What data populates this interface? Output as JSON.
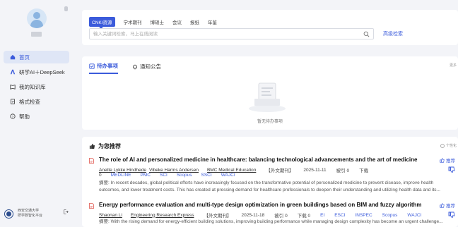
{
  "sidebar": {
    "items": [
      {
        "label": "首页",
        "icon": "home-icon",
        "active": true
      },
      {
        "label": "研学AI＋DeepSeek",
        "icon": "ai-icon"
      },
      {
        "label": "我的知识库",
        "icon": "book-icon"
      },
      {
        "label": "格式检查",
        "icon": "check-doc-icon"
      },
      {
        "label": "帮助",
        "icon": "help-icon"
      }
    ],
    "school_line1": "西安交通大学",
    "school_line2": "研学数智化平台"
  },
  "search": {
    "tabs": [
      "CNKI资源",
      "学术期刊",
      "博硕士",
      "会议",
      "报纸",
      "年鉴"
    ],
    "placeholder": "输入关键词检索，马上在线阅读",
    "value": "",
    "advanced_label": "高级检索"
  },
  "todo": {
    "tab_todo": "待办事项",
    "tab_notice": "通知公告",
    "more": "更多",
    "empty_text": "暂无待办事项"
  },
  "recommend": {
    "header": "为您推荐",
    "personalize": "个性化",
    "recommend_label": "推荐",
    "articles": [
      {
        "title": "The role of AI and personalized medicine in healthcare: balancing technological advancements and the art of medicine",
        "authors": [
          "Anette Lykke Hindhede",
          "Vibeke Harms Andersen"
        ],
        "source": "BMC Medical Education",
        "type": "【外文期刊】",
        "date": "2025-11-11",
        "cited": "被引 0",
        "download": "下载",
        "download_count": "0",
        "indexes": [
          "MEDLINE",
          "PMC",
          "SCI",
          "Scopus",
          "SSCI",
          "WAJCI"
        ],
        "abstract": "摘要: In recent decades, global political efforts have increasingly focused on the transformative potential of personalized medicine to prevent disease, improve health outcomes, and lower treatment costs. This has created at pressing demand for healthcare professionals to deepen their understanding and utilizing health data and its..."
      },
      {
        "title": "Energy performance evaluation and multi-type design optimization in green buildings based on BIM and fuzzy algorithm",
        "authors": [
          "Shaonan Li"
        ],
        "source": "Engineering Research Express",
        "type": "【外文期刊】",
        "date": "2025-11-18",
        "cited": "被引 0",
        "download": "下载 0",
        "indexes": [
          "EI",
          "ESCI",
          "INSPEC",
          "Scopus",
          "WAJCI"
        ],
        "abstract": "摘要: With the rising demand for energy-efficient building solutions, improving building performance while managing design complexity has become an urgent challenge..."
      }
    ]
  },
  "colors": {
    "accent": "#3b5bdb",
    "pdf": "#e0554d"
  }
}
